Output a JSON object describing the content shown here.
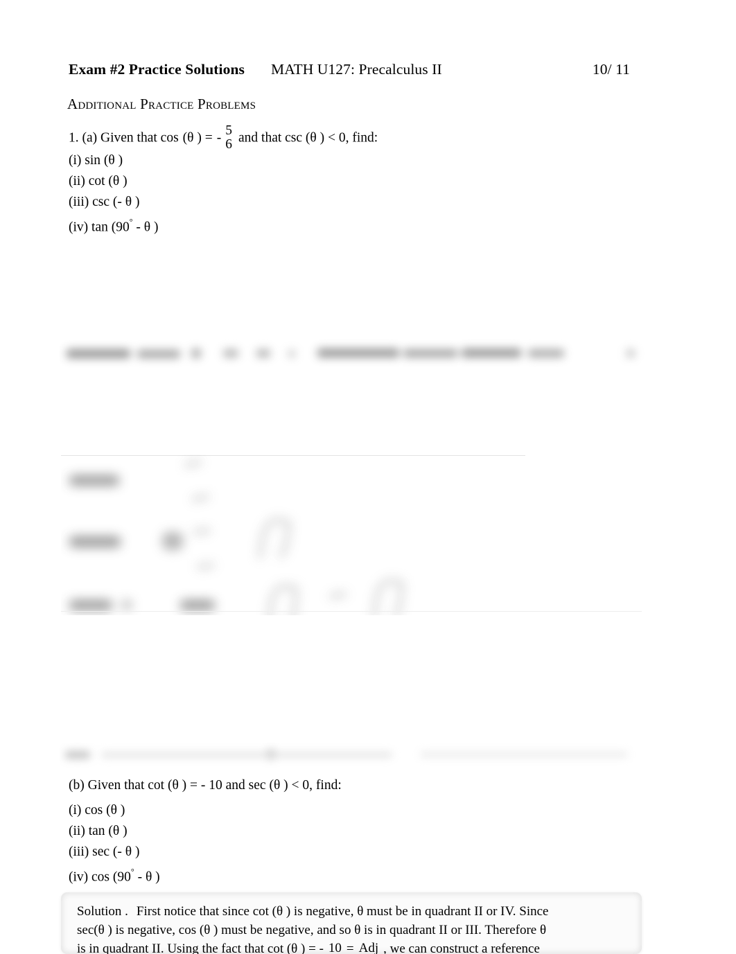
{
  "header": {
    "exam_title": "Exam #2 Practice Solutions",
    "course": "MATH U127: Precalculus II",
    "page_number": "10/ 11"
  },
  "section": {
    "heading": "Additional Practice Problems"
  },
  "problem_1a": {
    "prefix": "1.  (a) Given that cos",
    "fn_arg": "(θ ) =",
    "minus": "-",
    "fraction_numerator": "5",
    "fraction_denominator": "6",
    "suffix": "and that csc (θ ) <  0, find:",
    "items": [
      "(i) sin (θ )",
      "(ii) cot (θ )",
      "(iii) csc (- θ )",
      "(iv) tan (90",
      "(iv) tan (90° -  θ )"
    ],
    "item_i": "(i) sin (θ )",
    "item_ii": "(ii) cot (θ )",
    "item_iii": "(iii) csc (- θ )",
    "item_iv_pre": "(iv) tan (90",
    "item_iv_deg": "°",
    "item_iv_post": " -  θ )"
  },
  "problem_1b": {
    "text": "(b) Given that cot  (θ ) =  -  10 and sec (θ ) <  0, find:",
    "item_i": "(i) cos (θ )",
    "item_ii": "(ii) tan (θ )",
    "item_iii": "(iii) sec (- θ )",
    "item_iv_pre": "(iv) cos (90",
    "item_iv_deg": "°",
    "item_iv_post": " -  θ )"
  },
  "solution": {
    "label": "Solution .",
    "line1": "First notice that since cot  (θ ) is negative,  θ  must be in quadrant II or IV. Since",
    "line2": "sec(θ ) is negative, cos (θ ) must be negative, and so    θ  is in quadrant II or III. Therefore    θ",
    "line3_pre": "is in quadrant II. Using the fact that cot   (θ ) =  -",
    "line3_frac1_num": "10",
    "line3_equals": "=",
    "line3_frac2_num": "Adj",
    "line3_post": ", we can construct a reference"
  },
  "redacted": {
    "strip_1_note": "blurred text line",
    "block_2_note": "blurred equation lines",
    "strip_3_note": "blurred text line"
  },
  "colors": {
    "page_background": "#ffffff",
    "text": "#000000",
    "solution_box_background": "#fbfbfb",
    "blur_gray": "#9a9a9a"
  }
}
